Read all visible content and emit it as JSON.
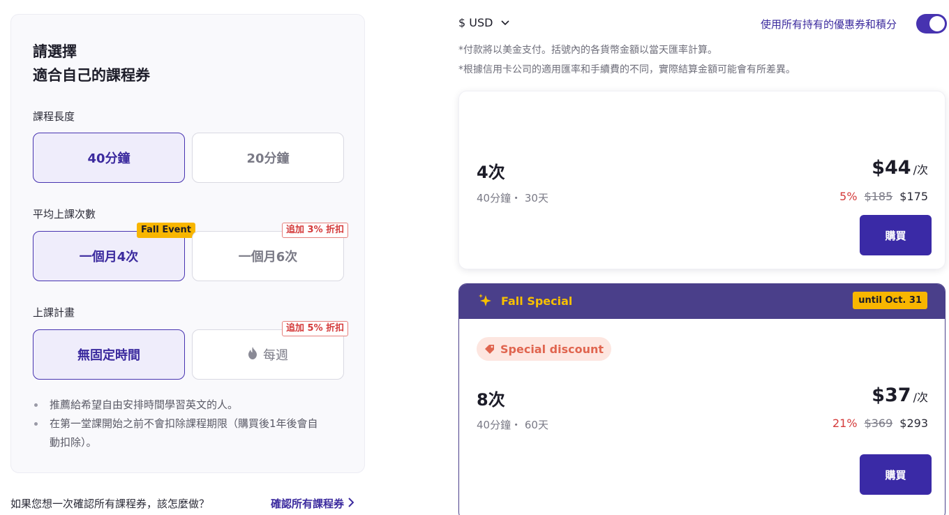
{
  "left": {
    "title_line1": "請選擇",
    "title_line2": "適合自己的課程券",
    "lesson_length": {
      "label": "課程長度",
      "options": [
        "40分鐘",
        "20分鐘"
      ]
    },
    "frequency": {
      "label": "平均上課次數",
      "options": [
        "一個月4次",
        "一個月6次"
      ],
      "event_badge": "Fall Event",
      "discount_badge": "追加 3% 折扣"
    },
    "plan": {
      "label": "上課計畫",
      "options": [
        "無固定時間",
        "每週"
      ],
      "discount_badge": "追加 5% 折扣"
    },
    "bullets": [
      "推薦給希望自由安排時間學習英文的人。",
      "在第一堂課開始之前不會扣除課程期限（購買後1年後會自",
      "動扣除）。"
    ]
  },
  "footer": {
    "question": "如果您想一次確認所有課程券，該怎麼做？",
    "link": "確認所有課程券"
  },
  "header": {
    "currency": "$ USD",
    "toggle_label": "使用所有持有的優惠券和積分",
    "toggle_on": true,
    "note1": "*付款將以美金支付。括號內的各貨幣金額以當天匯率計算。",
    "note2": "*根據信用卡公司的適用匯率和手續費的不同，實際結算金額可能會有所差異。"
  },
  "cards": [
    {
      "count": "4次",
      "detail": "40分鐘・ 30天",
      "price": "$44",
      "unit": "/次",
      "discount_pct": "5%",
      "original": "$185",
      "final": "$175",
      "buy": "購買"
    },
    {
      "special_title": "Fall Special",
      "until": "until Oct. 31",
      "pill": "Special discount",
      "count": "8次",
      "detail": "40分鐘・ 60天",
      "price": "$37",
      "unit": "/次",
      "discount_pct": "21%",
      "original": "$369",
      "final": "$293",
      "buy": "購買"
    }
  ],
  "colors": {
    "accent": "#3a2aa6",
    "special_header": "#4a3f8a",
    "gold": "#f8b600",
    "red": "#d43a3a"
  }
}
